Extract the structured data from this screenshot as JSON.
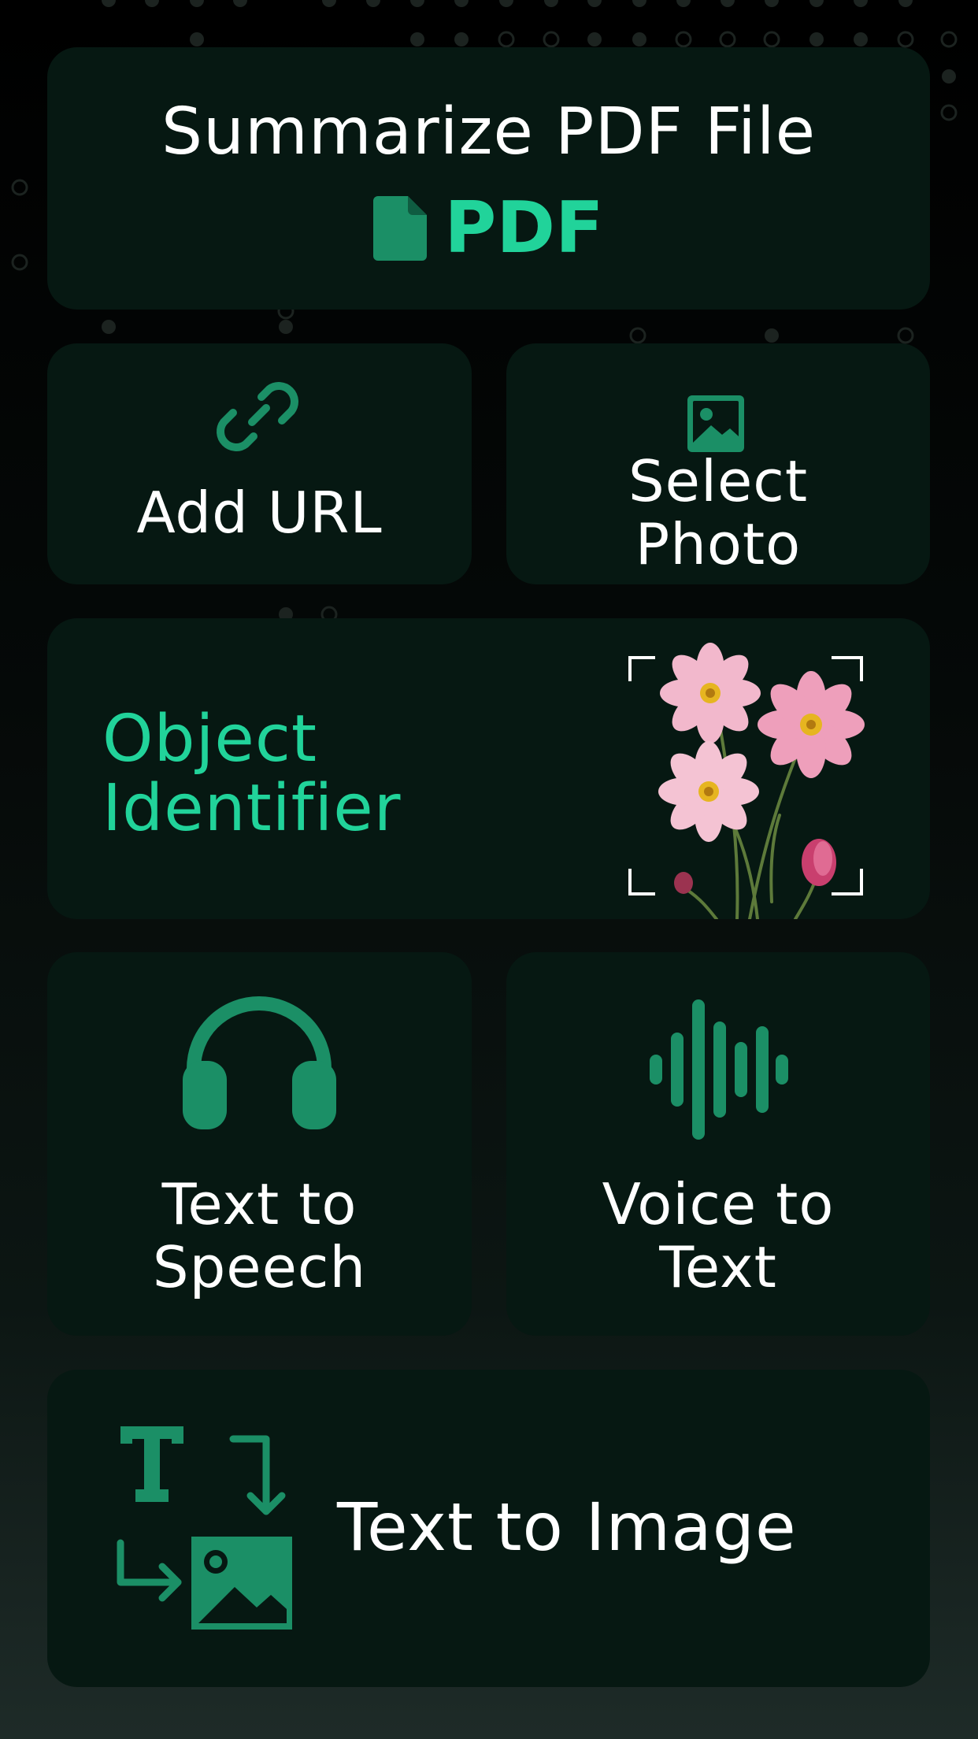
{
  "theme": {
    "card_background": "#061812",
    "accent": "#21d39a",
    "icon_color": "#1b8f66",
    "text_color": "#ffffff"
  },
  "pdf_card": {
    "title": "Summarize PDF File",
    "badge": "PDF",
    "icon": "file-icon"
  },
  "url_card": {
    "label": "Add URL",
    "icon": "link-icon"
  },
  "photo_card": {
    "label_line1": "Select",
    "label_line2": "Photo",
    "icon": "image-icon"
  },
  "object_card": {
    "label_line1": "Object",
    "label_line2": "Identifier",
    "image": "flowers-scan-image"
  },
  "tts_card": {
    "label_line1": "Text to",
    "label_line2": "Speech",
    "icon": "headphones-icon"
  },
  "vtt_card": {
    "label_line1": "Voice to",
    "label_line2": "Text",
    "icon": "waveform-icon"
  },
  "tti_card": {
    "label": "Text to Image",
    "icon": "text-to-image-icon"
  }
}
